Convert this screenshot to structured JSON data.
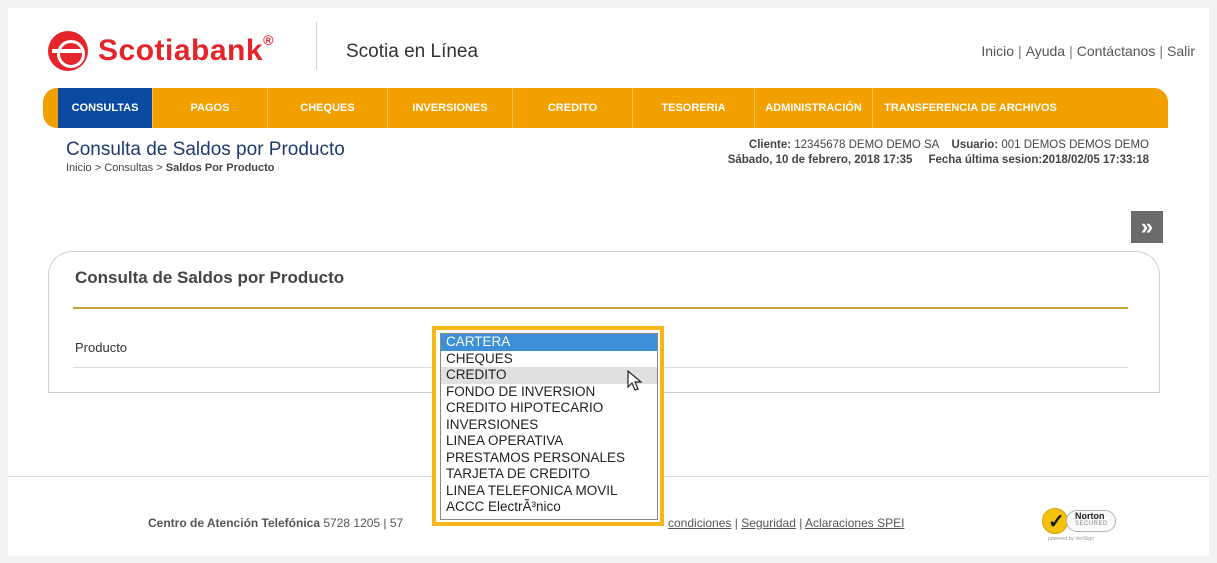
{
  "header": {
    "brand": "Scotiabank",
    "brand_mark": "®",
    "app_title": "Scotia en Línea",
    "links": [
      "Inicio",
      "Ayuda",
      "Contáctanos",
      "Salir"
    ]
  },
  "nav": {
    "items": [
      {
        "label": "CONSULTAS",
        "active": true
      },
      {
        "label": "PAGOS"
      },
      {
        "label": "CHEQUES"
      },
      {
        "label": "INVERSIONES"
      },
      {
        "label": "CREDITO"
      },
      {
        "label": "TESORERIA"
      },
      {
        "label": "ADMINISTRACIÓN"
      },
      {
        "label": "TRANSFERENCIA DE ARCHIVOS"
      }
    ]
  },
  "page": {
    "title": "Consulta de Saldos por Producto",
    "breadcrumb": {
      "home": "Inicio",
      "sep": ">",
      "section": "Consultas",
      "current": "Saldos Por Producto"
    }
  },
  "client": {
    "cliente_label": "Cliente:",
    "cliente_value": "12345678 DEMO DEMO SA",
    "usuario_label": "Usuario:",
    "usuario_value": "001 DEMOS DEMOS DEMO",
    "date": "Sábado, 10 de febrero, 2018 17:35",
    "last_session_label": "Fecha última sesion:",
    "last_session_value": "2018/02/05 17:33:18"
  },
  "next_button": {
    "icon": "double-chevron-right-icon",
    "glyph": "»"
  },
  "panel": {
    "title": "Consulta de Saldos por Producto",
    "field_label": "Producto"
  },
  "dropdown": {
    "selected": "CARTERA",
    "hovered": "CREDITO",
    "options": [
      "CARTERA",
      "CHEQUES",
      "CREDITO",
      "FONDO DE INVERSION",
      "CREDITO HIPOTECARIO",
      "INVERSIONES",
      "LINEA OPERATIVA",
      "PRESTAMOS PERSONALES",
      "TARJETA DE CREDITO",
      "LINEA TELEFONICA MOVIL",
      "ACCC ElectrÃ³nico"
    ]
  },
  "footer": {
    "phone_label": "Centro de Atención Telefónica",
    "phone_value": "5728 1205 | 57",
    "links_partial": "condiciones",
    "links": [
      "Seguridad",
      "Aclaraciones SPEI"
    ],
    "sep": "|"
  },
  "norton": {
    "name": "Norton",
    "secured": "SECURED",
    "powered": "powered by VeriSign"
  },
  "colors": {
    "brand_red": "#e4252b",
    "nav_orange": "#f1a000",
    "nav_active": "#0a4aa0",
    "highlight": "#f5b51b",
    "selection": "#3d8fd6"
  }
}
